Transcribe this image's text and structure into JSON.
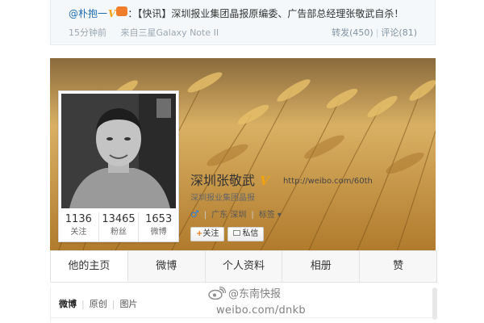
{
  "repost": {
    "user": "@朴抱一",
    "verified_mark": "V",
    "level_badge": "",
    "text": "：【快讯】深圳报业集团晶报原编委、广告部总经理张敬武自杀！",
    "time": "15分钟前",
    "source": "来自三星Galaxy Note II",
    "repost_label": "转发(450)",
    "separator": "|",
    "comment_label": "评论(81)"
  },
  "profile": {
    "name": "深圳张敬武",
    "verified_mark": "V",
    "vip_label": "",
    "url": "http://weibo.com/60th",
    "org": "深圳报业集团晶报",
    "gender_symbol": "♂",
    "location": "广东 深圳",
    "tags_label": "标签",
    "tags_caret": "▾",
    "follow_button": "关注",
    "follow_plus": "+",
    "message_button": "私信",
    "separator": "|",
    "stats": [
      {
        "value": "1136",
        "label": "关注"
      },
      {
        "value": "13465",
        "label": "粉丝"
      },
      {
        "value": "1653",
        "label": "微博"
      }
    ]
  },
  "tabs": [
    "他的主页",
    "微博",
    "个人资料",
    "相册",
    "赞"
  ],
  "subtabs": {
    "items": [
      "微博",
      "原创",
      "图片"
    ],
    "separator": "|"
  },
  "watermark": {
    "handle": "@东南快报",
    "url": "weibo.com/dnkb"
  },
  "colors": {
    "link_blue": "#1c6cb3",
    "verified_orange": "#f0a30a",
    "wheat_gold": "#c8933b",
    "male_blue": "#2b7de0"
  }
}
